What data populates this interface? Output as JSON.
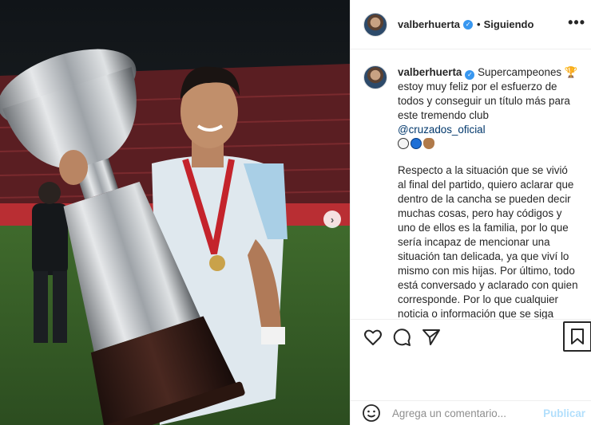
{
  "post": {
    "username": "valberhuerta",
    "verified_icon": "verified-badge-icon",
    "separator": "•",
    "follow_status": "Siguiendo",
    "more_label": "•••"
  },
  "caption": {
    "username": "valberhuerta",
    "first_text": "Supercampeones",
    "trophy_emoji": "🏆",
    "line_rest": "estoy muy feliz por el esfuerzo de todos y conseguir un título más para este tremendo club",
    "mention": "@cruzados_oficial",
    "paragraph2": "Respecto a la situación que se vivió al final del partido, quiero aclarar que dentro de la cancha se pueden decir muchas cosas, pero hay códigos y uno de ellos es la familia, por lo que sería incapaz de mencionar una situación tan delicada, ya que viví lo mismo con mis hijas. Por último, todo está conversado y aclarado con quien corresponde. Por lo que cualquier noticia o información que se siga divulgando está totalmente fuera de contexto."
  },
  "emoji_colors": {
    "white": "#f4f4f4",
    "blue": "#1d6fd6",
    "hand": "#b07a4a"
  },
  "comment": {
    "placeholder": "Agrega un comentario...",
    "publish_label": "Publicar"
  },
  "colors": {
    "accent": "#3897f0",
    "mention": "#00376b",
    "publish_disabled": "#b2dffc"
  }
}
